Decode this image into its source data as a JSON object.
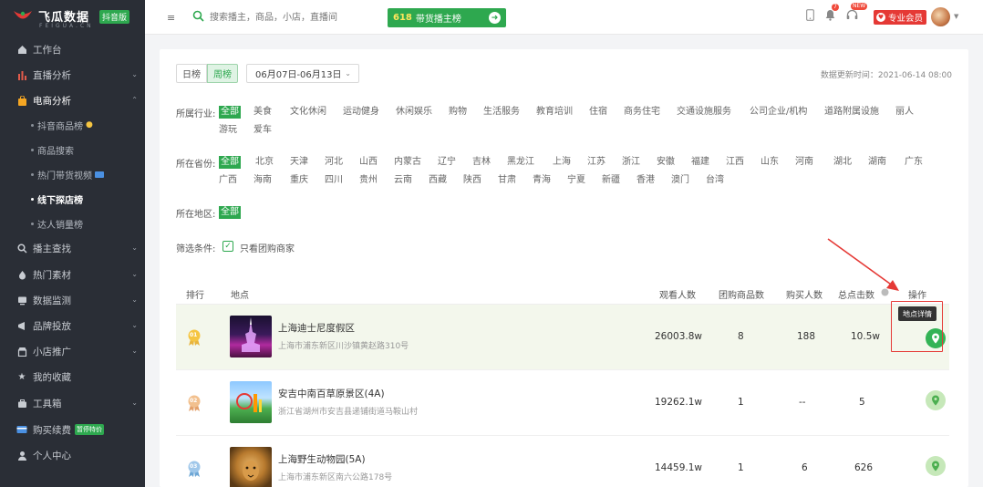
{
  "brand": {
    "name": "飞瓜数据",
    "edition": "抖音版",
    "pinyin": "FEIGUA.CN"
  },
  "sidebar": {
    "items": [
      {
        "label": "工作台",
        "icon": "home-icon"
      },
      {
        "label": "直播分析",
        "icon": "bar-chart-icon"
      },
      {
        "label": "电商分析",
        "icon": "shopping-bag-icon"
      },
      {
        "label": "播主查找",
        "icon": "search-icon"
      },
      {
        "label": "热门素材",
        "icon": "fire-icon"
      },
      {
        "label": "数据监测",
        "icon": "monitor-icon"
      },
      {
        "label": "品牌投放",
        "icon": "brand-icon"
      },
      {
        "label": "小店推广",
        "icon": "shop-icon"
      },
      {
        "label": "我的收藏",
        "icon": "star-icon"
      },
      {
        "label": "工具箱",
        "icon": "toolbox-icon"
      },
      {
        "label": "购买续费",
        "icon": "card-icon",
        "badge": "暂停特价"
      },
      {
        "label": "个人中心",
        "icon": "user-icon"
      }
    ],
    "sub_items": [
      "抖音商品榜",
      "商品搜索",
      "热门带货视频",
      "线下探店榜",
      "达人销量榜"
    ]
  },
  "header": {
    "search_placeholder": "搜索播主，商品，小店，直播间",
    "rank_button_num": "618",
    "rank_button_label": "带货播主榜",
    "msg_badge": "7",
    "notice_badge": "NEW",
    "vip_label": "专业会员"
  },
  "toolbar": {
    "day": "日榜",
    "week": "周榜",
    "date_range": "06月07日-06月13日",
    "update_time": "数据更新时间：2021-06-14 08:00"
  },
  "filters": {
    "industry_label": "所属行业:",
    "industry": [
      "全部",
      "美食",
      "文化休闲",
      "运动健身",
      "休闲娱乐",
      "购物",
      "生活服务",
      "教育培训",
      "住宿",
      "商务住宅",
      "交通设施服务",
      "公司企业/机构",
      "道路附属设施",
      "丽人",
      "游玩",
      "爱车"
    ],
    "province_label": "所在省份:",
    "province": [
      "全部",
      "北京",
      "天津",
      "河北",
      "山西",
      "内蒙古",
      "辽宁",
      "吉林",
      "黑龙江",
      "上海",
      "江苏",
      "浙江",
      "安徽",
      "福建",
      "江西",
      "山东",
      "河南",
      "湖北",
      "湖南",
      "广东",
      "广西",
      "海南",
      "重庆",
      "四川",
      "贵州",
      "云南",
      "西藏",
      "陕西",
      "甘肃",
      "青海",
      "宁夏",
      "新疆",
      "香港",
      "澳门",
      "台湾"
    ],
    "region_label": "所在地区:",
    "region": [
      "全部"
    ],
    "condition_label": "筛选条件:",
    "condition_option": "只看团购商家"
  },
  "table": {
    "headers": {
      "rank": "排行",
      "place": "地点",
      "viewers": "观看人数",
      "group_goods": "团购商品数",
      "buyers": "购买人数",
      "clicks": "总点击数",
      "action": "操作"
    },
    "rows": [
      {
        "rank": "01",
        "name": "上海迪士尼度假区",
        "address": "上海市浦东新区川沙镇黄赵路310号",
        "viewers": "26003.8w",
        "group_goods": "8",
        "buyers": "188",
        "clicks": "10.5w"
      },
      {
        "rank": "02",
        "name": "安吉中南百草原景区(4A)",
        "address": "浙江省湖州市安吉县递铺街道马鞍山村",
        "viewers": "19262.1w",
        "group_goods": "1",
        "buyers": "--",
        "clicks": "5"
      },
      {
        "rank": "03",
        "name": "上海野生动物园(5A)",
        "address": "上海市浦东新区南六公路178号",
        "viewers": "14459.1w",
        "group_goods": "1",
        "buyers": "6",
        "clicks": "626"
      }
    ],
    "tooltip": "地点详情"
  },
  "colors": {
    "accent": "#2ea84f",
    "sidebar_bg": "#2a2e36",
    "highlight": "#e53935"
  }
}
